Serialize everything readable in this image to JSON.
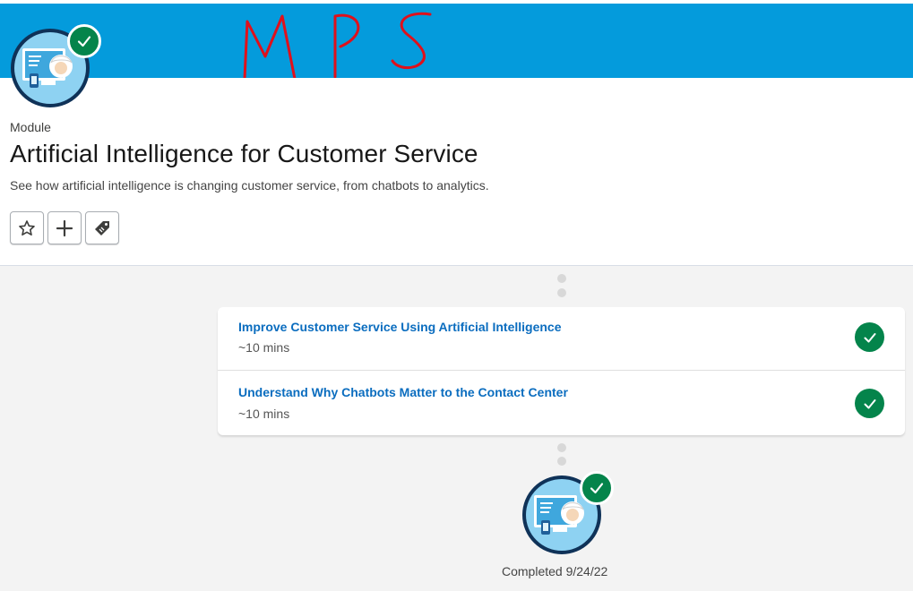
{
  "header": {
    "kicker": "Module",
    "title": "Artificial Intelligence for Customer Service",
    "description": "See how artificial intelligence is changing customer service, from chatbots to analytics."
  },
  "annotation": {
    "handwritten_text": "MPS",
    "color": "#e0101b"
  },
  "actions": [
    {
      "name": "favorite",
      "icon": "star-icon"
    },
    {
      "name": "add-to-list",
      "icon": "plus-icon"
    },
    {
      "name": "tag",
      "icon": "tag-icon"
    }
  ],
  "units": [
    {
      "title": "Improve Customer Service Using Artificial Intelligence",
      "duration": "~10 mins",
      "status": "completed"
    },
    {
      "title": "Understand Why Chatbots Matter to the Contact Center",
      "duration": "~10 mins",
      "status": "completed"
    }
  ],
  "completion": {
    "label": "Completed 9/24/22"
  },
  "colors": {
    "banner": "#049bdc",
    "success": "#04844b",
    "link": "#0b6dbf"
  }
}
